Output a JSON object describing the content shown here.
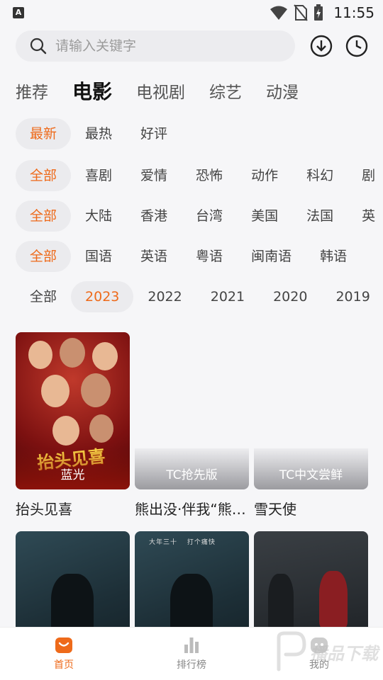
{
  "status_bar": {
    "time": "11:55",
    "app_icon_letter": "A"
  },
  "search": {
    "placeholder": "请输入关键字"
  },
  "main_tabs": [
    "推荐",
    "电影",
    "电视剧",
    "综艺",
    "动漫"
  ],
  "filters": {
    "sort": [
      "最新",
      "最热",
      "好评"
    ],
    "genre": [
      "全部",
      "喜剧",
      "爱情",
      "恐怖",
      "动作",
      "科幻",
      "剧"
    ],
    "region": [
      "全部",
      "大陆",
      "香港",
      "台湾",
      "美国",
      "法国",
      "英"
    ],
    "language": [
      "全部",
      "国语",
      "英语",
      "粤语",
      "闽南语",
      "韩语"
    ],
    "year": [
      "全部",
      "2023",
      "2022",
      "2021",
      "2020",
      "2019"
    ]
  },
  "movies": [
    {
      "title": "抬头见喜",
      "badge": "蓝光",
      "poster_text": "抬头见喜"
    },
    {
      "title": "熊出没·伴我“熊芯”",
      "badge": "TC抢先版"
    },
    {
      "title": "雪天使",
      "badge": "TC中文尝鲜"
    },
    {
      "poster_text_top": "大年三十 　打个痛快"
    },
    {},
    {}
  ],
  "bottom_nav": [
    {
      "label": "首页"
    },
    {
      "label": "排行榜"
    },
    {
      "label": "我的"
    }
  ],
  "watermark": {
    "text": "播品下载"
  },
  "colors": {
    "accent": "#ee6a1a",
    "chip_bg": "#ebebee",
    "background": "#f6f6f8"
  }
}
